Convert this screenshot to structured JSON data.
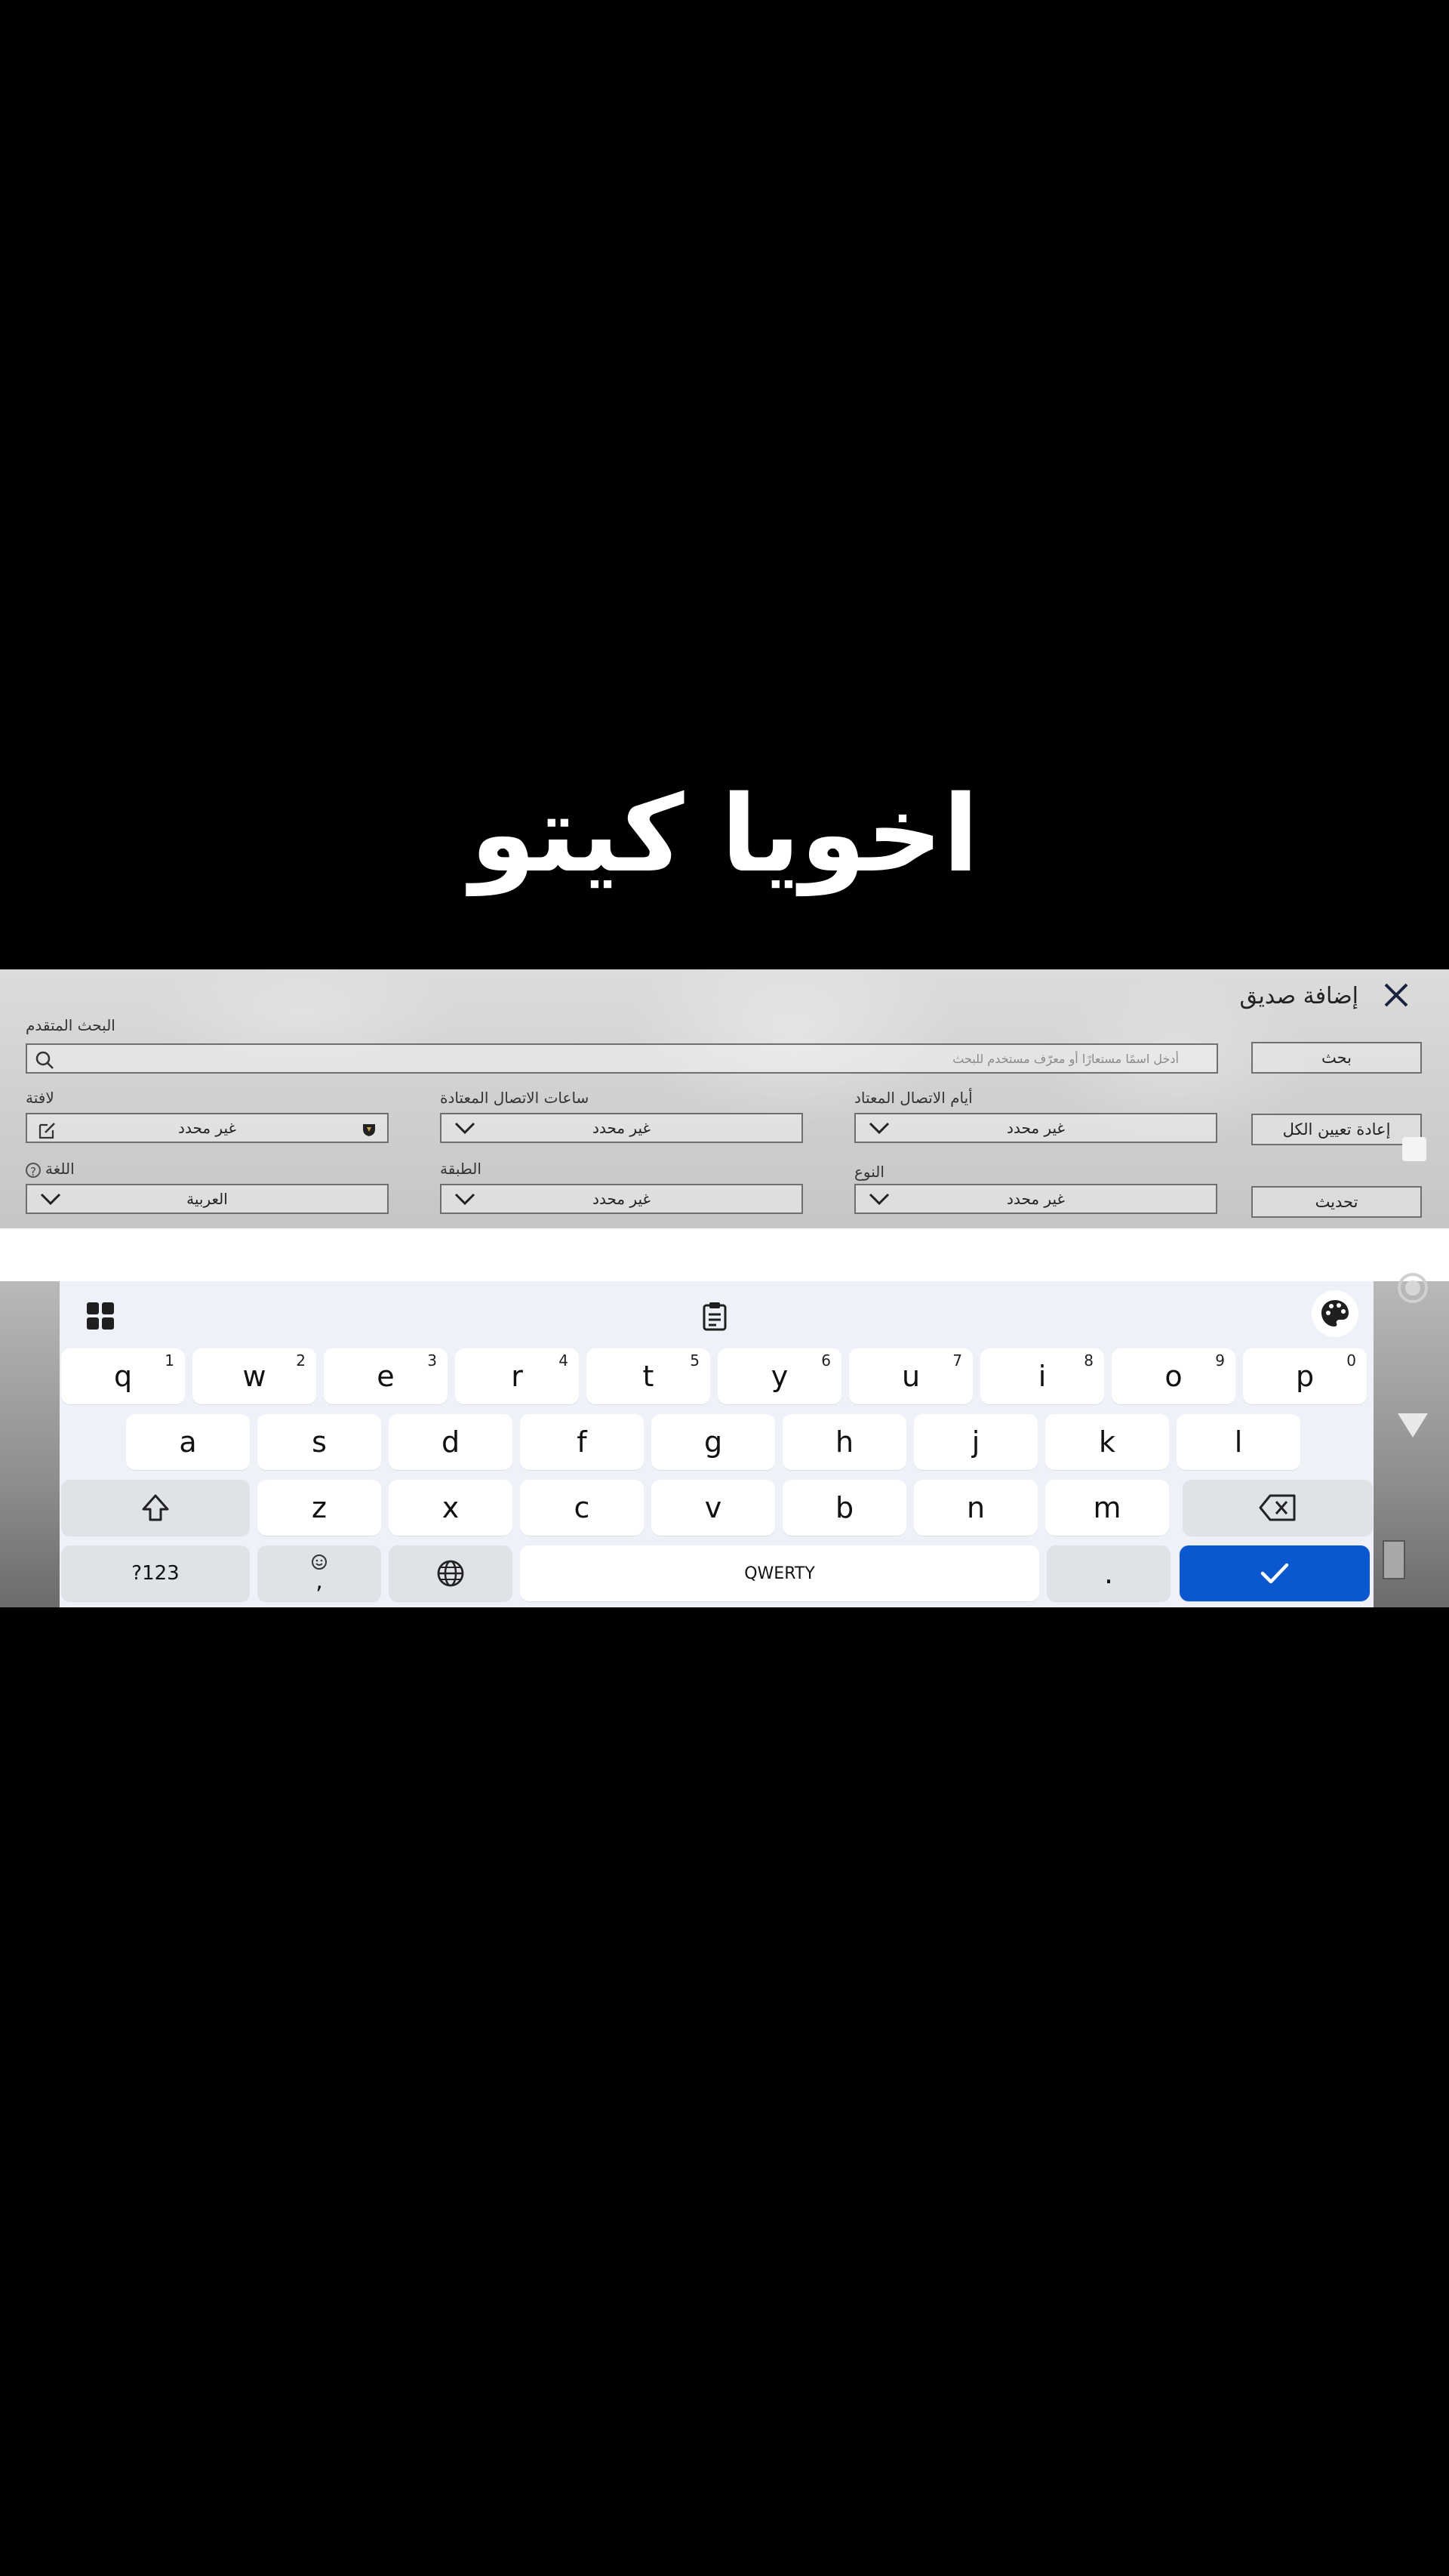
{
  "overlay_caption": "اخويا كيتو",
  "panel": {
    "title": "إضافة صديق",
    "advanced_search_label": "البحث المتقدم",
    "search_placeholder": "أدخل اسمًا مستعارًا أو معرّف مستخدم للبحث",
    "buttons": {
      "search": "بحث",
      "reset_all": "إعادة تعيين الكل",
      "refresh": "تحديث"
    },
    "filters": {
      "usual_days": {
        "label": "أيام الاتصال المعتاد",
        "value": "غير محدد"
      },
      "usual_hours": {
        "label": "ساعات الاتصال المعتادة",
        "value": "غير محدد"
      },
      "clan": {
        "label": "لافتة",
        "value": "غير محدد"
      },
      "gender": {
        "label": "النوع",
        "value": "غير محدد"
      },
      "tier": {
        "label": "الطبقة",
        "value": "غير محدد"
      },
      "language": {
        "label": "اللغة",
        "value": "العربية"
      }
    }
  },
  "keyboard": {
    "row1": [
      {
        "k": "q",
        "n": "1"
      },
      {
        "k": "w",
        "n": "2"
      },
      {
        "k": "e",
        "n": "3"
      },
      {
        "k": "r",
        "n": "4"
      },
      {
        "k": "t",
        "n": "5"
      },
      {
        "k": "y",
        "n": "6"
      },
      {
        "k": "u",
        "n": "7"
      },
      {
        "k": "i",
        "n": "8"
      },
      {
        "k": "o",
        "n": "9"
      },
      {
        "k": "p",
        "n": "0"
      }
    ],
    "row2": [
      "a",
      "s",
      "d",
      "f",
      "g",
      "h",
      "j",
      "k",
      "l"
    ],
    "row3": [
      "z",
      "x",
      "c",
      "v",
      "b",
      "n",
      "m"
    ],
    "symbols_key": "?123",
    "emoji_comma": ",",
    "space_label": "QWERTY",
    "period_key": ".",
    "accent_color": "#0b57d0"
  }
}
